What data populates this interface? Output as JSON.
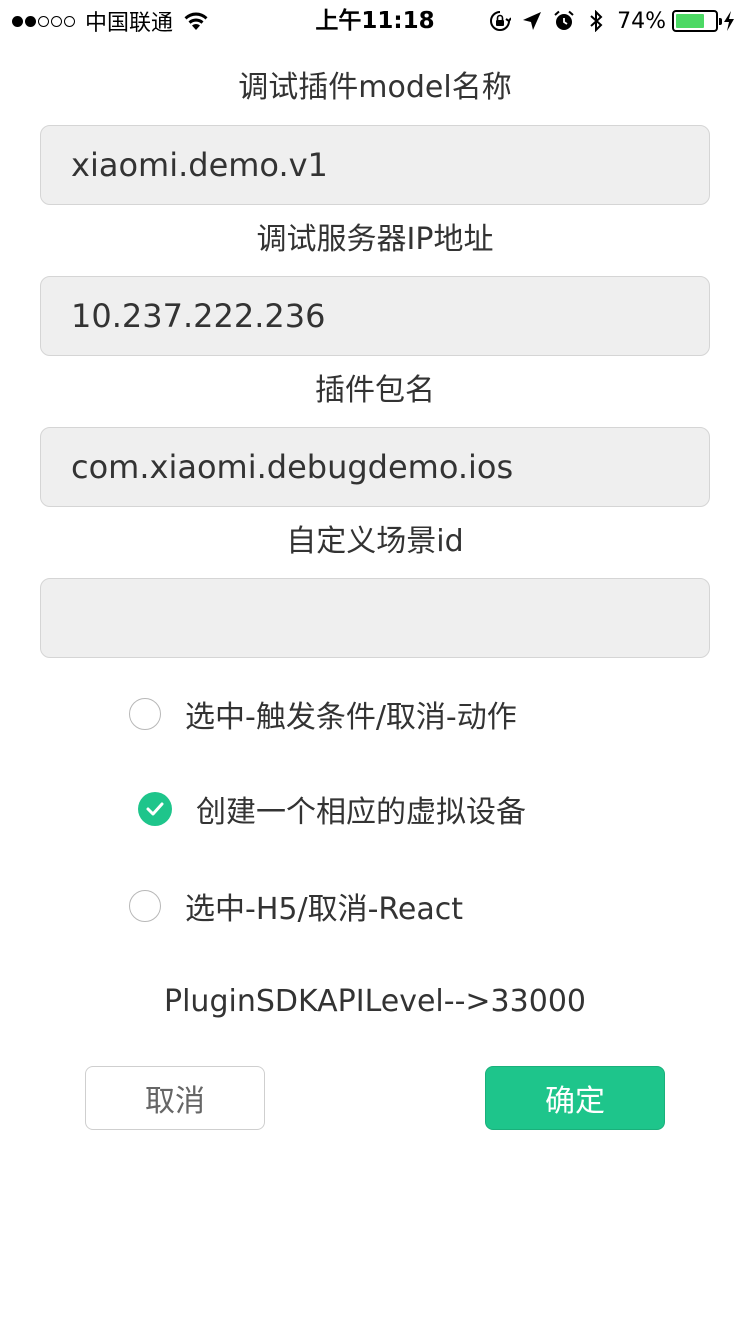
{
  "status_bar": {
    "carrier": "中国联通",
    "time": "上午11:18",
    "battery_percent": "74%",
    "battery_level": 0.74,
    "signal_bars_filled": 2,
    "signal_bars_total": 5,
    "icons": [
      "wifi-icon",
      "orientation-lock-icon",
      "location-arrow-icon",
      "alarm-icon",
      "bluetooth-icon",
      "battery-icon",
      "charging-icon"
    ]
  },
  "form": {
    "model_label": "调试插件model名称",
    "model_value": "xiaomi.demo.v1",
    "ip_label": "调试服务器IP地址",
    "ip_value": "10.237.222.236",
    "package_label": "插件包名",
    "package_value": "com.xiaomi.debugdemo.ios",
    "scene_label": "自定义场景id",
    "scene_value": ""
  },
  "options": [
    {
      "label": "选中-触发条件/取消-动作",
      "checked": false
    },
    {
      "label": "创建一个相应的虚拟设备",
      "checked": true
    },
    {
      "label": "选中-H5/取消-React",
      "checked": false
    }
  ],
  "sdk_level_text": "PluginSDKAPILevel-->33000",
  "buttons": {
    "cancel": "取消",
    "confirm": "确定"
  },
  "colors": {
    "accent": "#1ec58b",
    "field_bg": "#efefef",
    "battery": "#4cd964"
  }
}
